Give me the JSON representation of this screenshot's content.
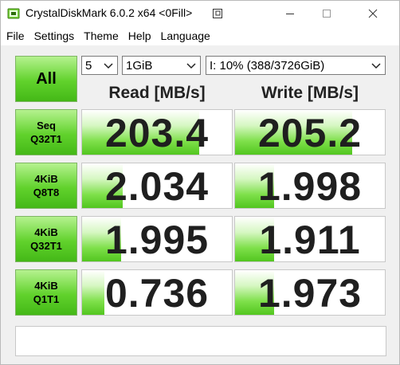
{
  "window": {
    "title": "CrystalDiskMark 6.0.2 x64 <0Fill>",
    "icons": {
      "app": "disk-app-icon",
      "pin": "pin-window-icon",
      "minimize": "minimize-icon",
      "maximize": "maximize-icon",
      "close": "close-icon"
    }
  },
  "menu": {
    "items": [
      "File",
      "Settings",
      "Theme",
      "Help",
      "Language"
    ]
  },
  "controls": {
    "all_label": "All",
    "count_value": "5",
    "size_value": "1GiB",
    "drive_value": "I: 10% (388/3726GiB)"
  },
  "columns": {
    "read_label": "Read [MB/s]",
    "write_label": "Write [MB/s]"
  },
  "tests": [
    {
      "line1": "Seq",
      "line2": "Q32T1",
      "read": "203.4",
      "write": "205.2",
      "read_fill": 0.78,
      "write_fill": 0.78
    },
    {
      "line1": "4KiB",
      "line2": "Q8T8",
      "read": "2.034",
      "write": "1.998",
      "read_fill": 0.27,
      "write_fill": 0.26
    },
    {
      "line1": "4KiB",
      "line2": "Q32T1",
      "read": "1.995",
      "write": "1.911",
      "read_fill": 0.26,
      "write_fill": 0.26
    },
    {
      "line1": "4KiB",
      "line2": "Q1T1",
      "read": "0.736",
      "write": "1.973",
      "read_fill": 0.15,
      "write_fill": 0.26
    }
  ],
  "status": {
    "text": ""
  },
  "colors": {
    "accent_green": "#61d22c",
    "bar_green": "#52c61f"
  }
}
